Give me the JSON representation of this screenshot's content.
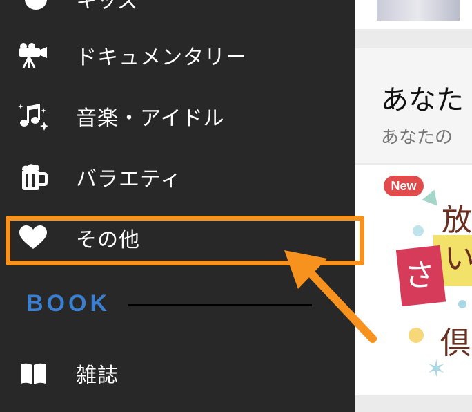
{
  "sidebar": {
    "partial_item_label": "キッズ",
    "items": [
      {
        "label": "ドキュメンタリー",
        "icon": "film-camera-icon"
      },
      {
        "label": "音楽・アイドル",
        "icon": "music-note-icon"
      },
      {
        "label": "バラエティ",
        "icon": "beer-mug-icon"
      },
      {
        "label": "その他",
        "icon": "heart-icon"
      }
    ],
    "section_title": "BOOK",
    "book_items": [
      {
        "label": "雑誌",
        "icon": "open-book-icon"
      }
    ]
  },
  "main": {
    "heading": "あなた",
    "subheading": "あなたの",
    "card_badge": "New",
    "card_art_text": [
      "放",
      "い",
      "さ",
      "倶"
    ]
  },
  "colors": {
    "sidebar_bg": "#282828",
    "section_title": "#3b7fd0",
    "highlight": "#f7921e",
    "badge": "#e24b4b"
  }
}
